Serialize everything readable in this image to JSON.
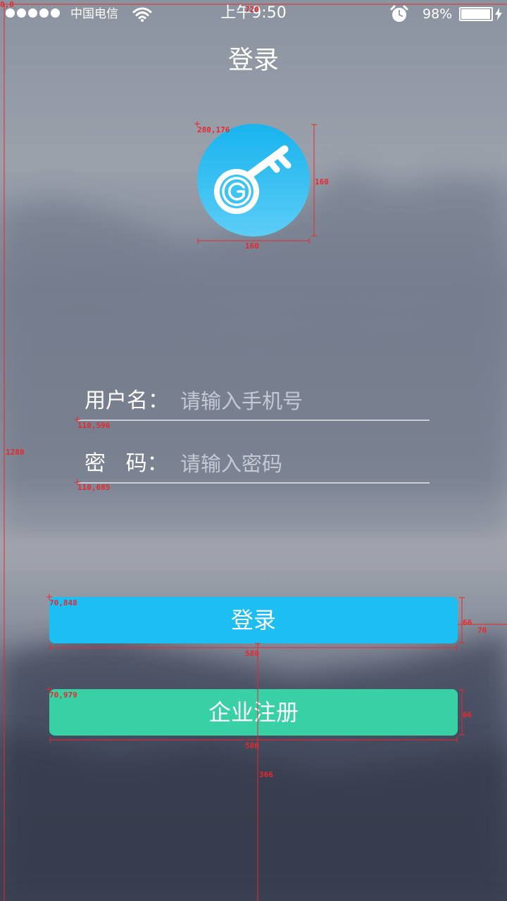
{
  "status_bar": {
    "carrier": "中国电信",
    "time": "上午9:50",
    "battery_percent": "98%",
    "battery_level": 0.98,
    "signal_bars": 5,
    "icons": [
      "signal-dots-icon",
      "wifi-icon",
      "alarm-clock-icon",
      "battery-icon",
      "charging-bolt-icon"
    ]
  },
  "header": {
    "title": "登录"
  },
  "logo": {
    "icon": "key-icon",
    "color": "#1dbef4"
  },
  "form": {
    "username": {
      "label": "用户名：",
      "placeholder": "请输入手机号",
      "value": ""
    },
    "password": {
      "label": "密   码：",
      "placeholder": "请输入密码",
      "value": ""
    }
  },
  "buttons": {
    "login": {
      "label": "登录",
      "color": "#1dbef4"
    },
    "register": {
      "label": "企业注册",
      "color": "#38d1a6"
    }
  },
  "annotations": {
    "color": "#e8282d",
    "labels": [
      "0,0",
      "720",
      "1280",
      "280,176",
      "160",
      "160",
      "110,596",
      "110,685",
      "70,848",
      "66",
      "70",
      "580",
      "70,979",
      "66",
      "580",
      "366"
    ]
  }
}
